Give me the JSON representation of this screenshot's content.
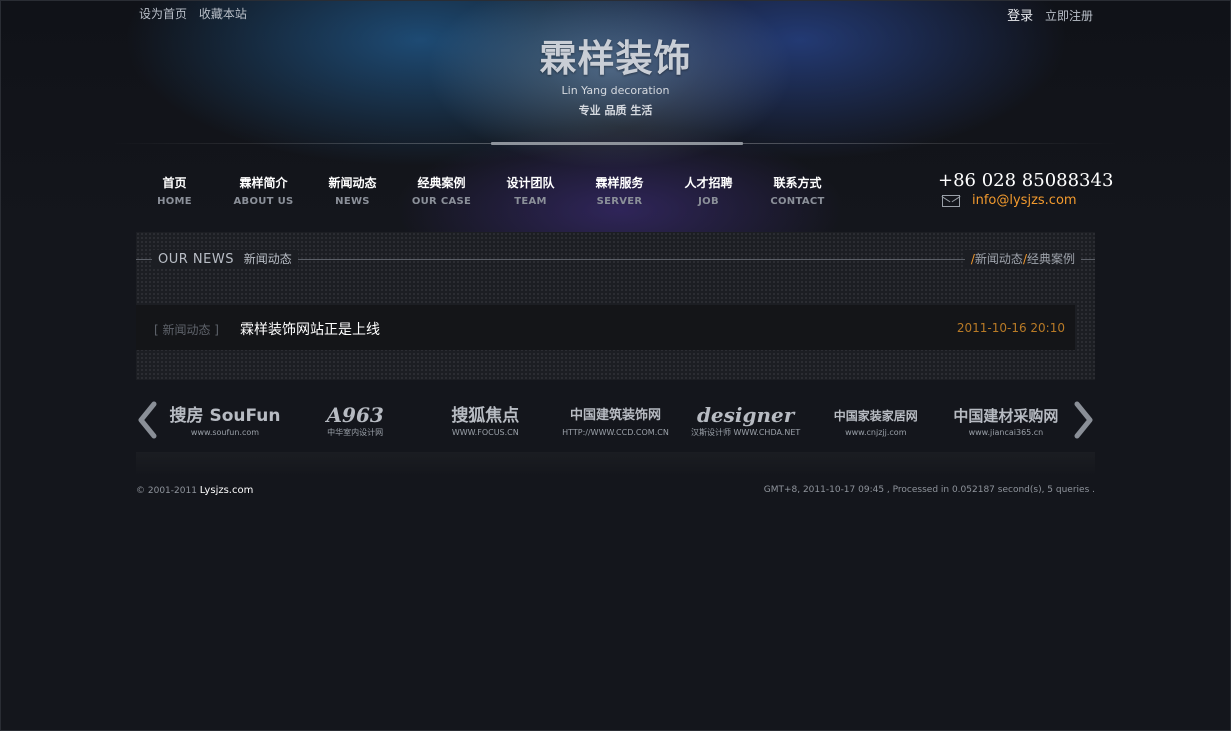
{
  "top_bar": {
    "left_links": [
      "设为首页",
      "收藏本站"
    ],
    "login": "登录",
    "register": "立即注册"
  },
  "logo": {
    "title": "霖样装饰",
    "subtitle": "Lin Yang decoration",
    "slogan": "专业 品质 生活"
  },
  "nav": [
    {
      "cn": "首页",
      "en": "HOME"
    },
    {
      "cn": "霖样简介",
      "en": "ABOUT US"
    },
    {
      "cn": "新闻动态",
      "en": "NEWS"
    },
    {
      "cn": "经典案例",
      "en": "OUR CASE"
    },
    {
      "cn": "设计团队",
      "en": "TEAM"
    },
    {
      "cn": "霖样服务",
      "en": "SERVER"
    },
    {
      "cn": "人才招聘",
      "en": "JOB"
    },
    {
      "cn": "联系方式",
      "en": "CONTACT"
    }
  ],
  "contact": {
    "phone": "+86 028 85088343",
    "email": "info@lysjzs.com"
  },
  "news_section": {
    "title_en": "OUR   NEWS",
    "title_cn": "新闻动态",
    "link_news": "新闻动态",
    "link_case": "经典案例",
    "slash": "/"
  },
  "news_items": [
    {
      "tag": "[ 新闻动态 ]",
      "title": "霖样装饰网站正是上线",
      "date": "2011-10-16 20:10"
    }
  ],
  "partners": [
    {
      "main": "搜房 SouFun",
      "sub": "www.soufun.com"
    },
    {
      "main": "A963",
      "sub": "中华室内设计网"
    },
    {
      "main": "搜狐焦点",
      "sub": "WWW.FOCUS.CN"
    },
    {
      "main": "中国建筑装饰网",
      "sub": "HTTP://WWW.CCD.COM.CN"
    },
    {
      "main": "designer",
      "sub": "汉斯设计师 WWW.CHDA.NET"
    },
    {
      "main": "中国家装家居网",
      "sub": "www.cnjzjj.com"
    },
    {
      "main": "中国建材采购网",
      "sub": "www.jiancai365.cn"
    }
  ],
  "footer": {
    "copyright": "© 2001-2011 ",
    "site": "Lysjzs.com",
    "stats": "GMT+8, 2011-10-17 09:45 , Processed in 0.052187 second(s), 5 queries ."
  },
  "icons": {
    "mail": "mail-icon",
    "prev": "chevron-left-icon",
    "next": "chevron-right-icon"
  },
  "colors": {
    "accent": "#f29a2e",
    "date": "#b87a26",
    "background": "#14161c"
  }
}
